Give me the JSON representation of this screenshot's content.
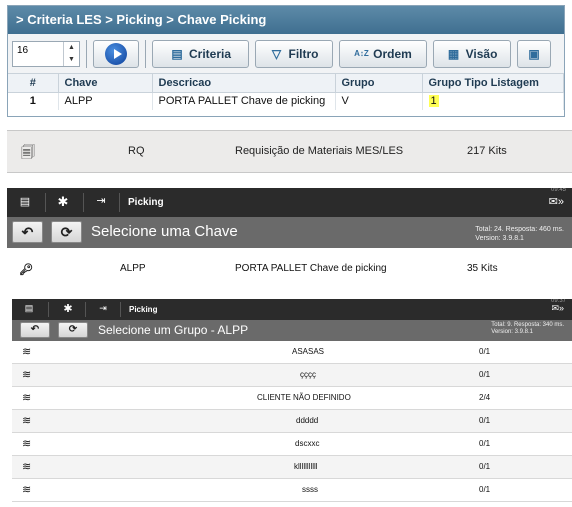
{
  "panel1": {
    "breadcrumb": "> Criteria LES > Picking > Chave Picking",
    "spinner_value": "16",
    "toolbar": {
      "criteria": "Criteria",
      "filtro": "Filtro",
      "ordem": "Ordem",
      "visao": "Visão"
    },
    "columns": [
      "#",
      "Chave",
      "Descricao",
      "Grupo",
      "Grupo Tipo Listagem"
    ],
    "row": {
      "num": "1",
      "chave": "ALPP",
      "descricao": "PORTA PALLET Chave de picking",
      "grupo": "V",
      "tipo": "1"
    }
  },
  "panel2": {
    "code": "RQ",
    "description": "Requisição de Materiais MES/LES",
    "count": "217 Kits"
  },
  "panel3": {
    "title": "Picking",
    "heading": "Selecione uma Chave",
    "info_line1": "Total: 24. Resposta: 460 ms.",
    "info_line2": "Version: 3.9.8.1",
    "item": {
      "code": "ALPP",
      "description": "PORTA PALLET Chave de picking",
      "count": "35 Kits"
    }
  },
  "panel4": {
    "title": "Picking",
    "heading": "Selecione um Grupo - ALPP",
    "info_line1": "Total: 9. Resposta: 340 ms.",
    "info_line2": "Version: 3.9.8.1",
    "items": [
      {
        "name": "ASASAS",
        "count": "0/1"
      },
      {
        "name": "çççç",
        "count": "0/1"
      },
      {
        "name": "CLIENTE NÃO DEFINIDO",
        "count": "2/4"
      },
      {
        "name": "ddddd",
        "count": "0/1"
      },
      {
        "name": "dscxxc",
        "count": "0/1"
      },
      {
        "name": "klllllllllll",
        "count": "0/1"
      },
      {
        "name": "ssss",
        "count": "0/1"
      }
    ]
  }
}
